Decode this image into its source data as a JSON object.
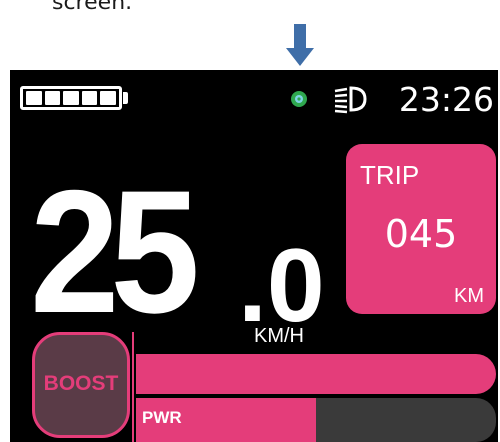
{
  "caption": {
    "text": "screen."
  },
  "status": {
    "battery_cells": 5,
    "clock": "23:26"
  },
  "speed": {
    "integer": "25",
    "decimal": ".0",
    "unit": "KM/H"
  },
  "trip": {
    "label": "TRIP",
    "value": "045",
    "unit": "KM"
  },
  "assist": {
    "boost_label": "BOOST",
    "pwr_label": "PWR",
    "power_level": 0.5
  },
  "colors": {
    "accent": "#e43d7a",
    "arrow": "#3f6ea8",
    "gps": "#2fa84f"
  }
}
